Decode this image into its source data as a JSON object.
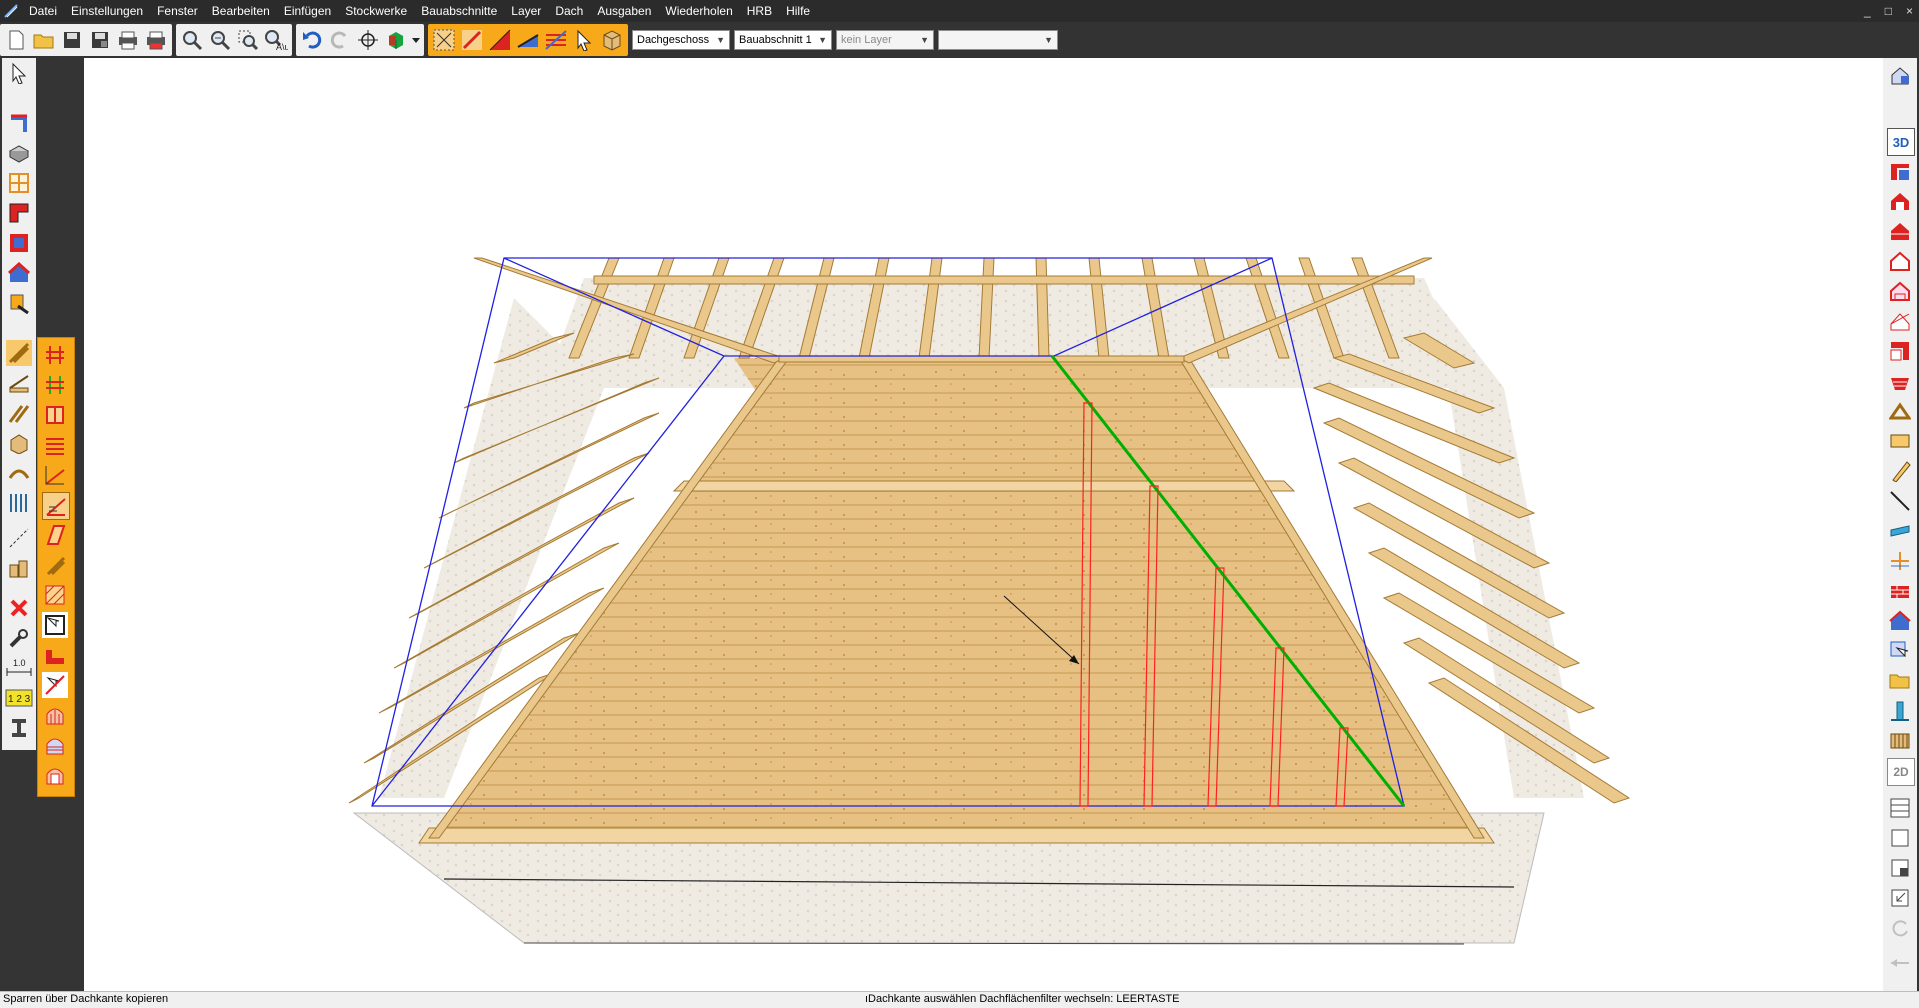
{
  "menu": [
    "Datei",
    "Einstellungen",
    "Fenster",
    "Bearbeiten",
    "Einfügen",
    "Stockwerke",
    "Bauabschnitte",
    "Layer",
    "Dach",
    "Ausgaben",
    "Wiederholen",
    "HRB",
    "Hilfe"
  ],
  "window_controls": [
    "_",
    "□",
    "×"
  ],
  "toolbar": {
    "floor_select": "Dachgeschoss",
    "section_select": "Bauabschnitt 1",
    "layer_select": "kein Layer",
    "extra_select": ""
  },
  "right_toolbar": {
    "view_3d_label": "3D",
    "view_2d_label": "2D"
  },
  "left_toolbar": {
    "dim_label": "1.0",
    "num_label": "1 2 3"
  },
  "status": {
    "left": "Sparren über Dachkante kopieren",
    "center": "ıDachkante auswählen Dachflächenfilter wechseln: LEERTASTE"
  },
  "colors": {
    "accent_orange": "#f7a91a",
    "selection_green": "#00b000",
    "roof_outline_blue": "#2020e0",
    "preview_red": "#ff2020",
    "wood": "#e3bb7a"
  }
}
